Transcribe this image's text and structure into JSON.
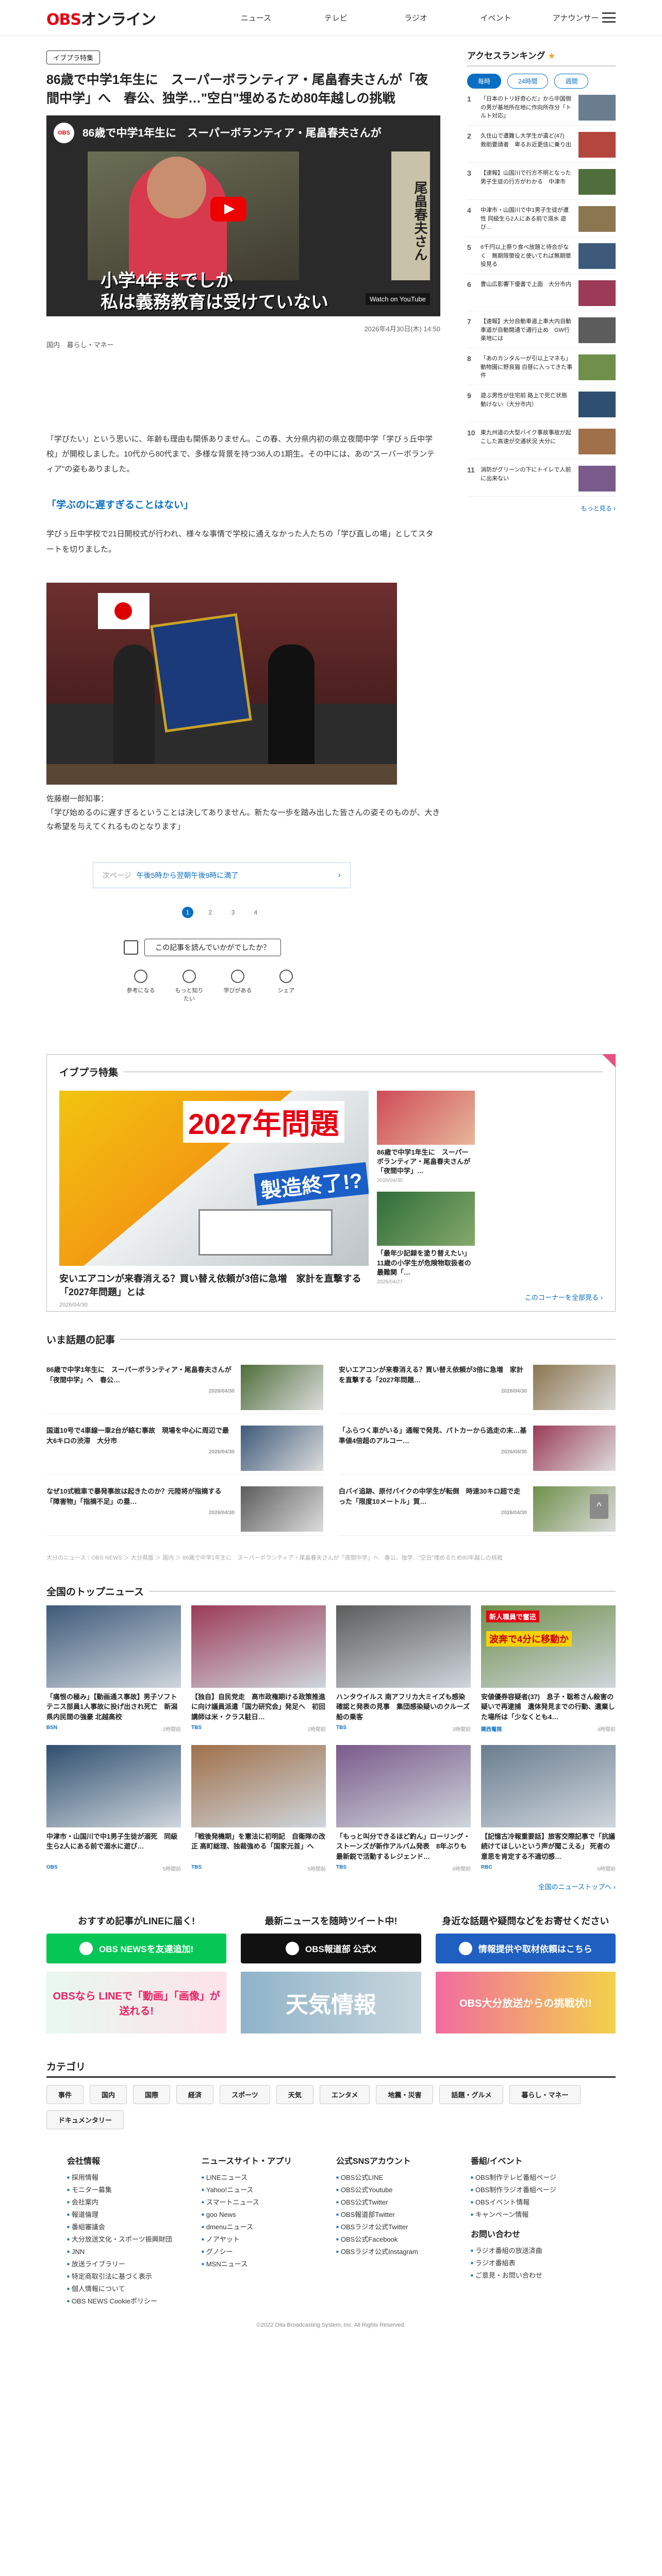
{
  "header": {
    "logo_prefix": "OBS",
    "logo_suffix": "オンライン",
    "nav": [
      "ニュース",
      "テレビ",
      "ラジオ",
      "イベント",
      "アナウンサー"
    ]
  },
  "article": {
    "badge": "イブプラ特集",
    "title": "86歳で中学1年生に　スーパーボランティア・尾畠春夫さんが「夜間中学」へ　春公、独学…\"空白\"埋めるため80年越しの挑戦",
    "video": {
      "channel": "OBS",
      "title": "86歳で中学1年生に　スーパーボランティア・尾畠春夫さんが",
      "sign": "尾畠春夫さん",
      "caption_line1": "小学4年までしか",
      "caption_line2": "私は義務教育は受けていない",
      "watch": "Watch on YouTube"
    },
    "date": "2026年4月30日(木) 14:50",
    "tags": [
      "国内",
      "暮らし・マネー"
    ],
    "paragraph1": "「学びたい」という思いに、年齢も理由も関係ありません。この春、大分県内初の県立夜間中学「学びぅ丘中学校」が開校しました。10代から80代まで、多様な背景を持つ36人の1期生。その中には、あの\"スーパーボランティア\"の姿もありました。",
    "subhead": "「学ぶのに遅すぎることはない」",
    "paragraph2": "学びぅ丘中学校で21日開校式が行われ、様々な事情で学校に通えなかった人たちの「学び直しの場」としてスタートを切りました。",
    "quote_name": "佐藤樹一郎知事：",
    "quote_text": "「学び始めるのに遅すぎるということは決してありません。新たな一歩を踏み出した皆さんの姿そのものが、大きな希望を与えてくれるものとなります」",
    "next_label": "次ページ",
    "next_text": "午後5時から翌朝午後9時に満了",
    "next_arrow": "›",
    "pages": [
      "1",
      "2",
      "3",
      "4"
    ],
    "read_question": "この記事を読んでいかがでしたか？",
    "reactions": [
      "参考になる",
      "もっと知りたい",
      "学びがある",
      "シェア"
    ]
  },
  "feature": {
    "heading": "イブプラ特集",
    "main_title": "安いエアコンが来春消える？買い替え依頼が3倍に急増　家計を直撃する「2027年問題」とは",
    "main_date": "2026/04/30",
    "img_text1": "2027年問題",
    "img_text2": "製造終了!?",
    "side": [
      {
        "title": "86歳で中学1年生に　スーパーボランティア・尾畠春夫さんが「夜間中学」…",
        "date": "2026/04/30"
      },
      {
        "title": "「最年少記録を塗り替えたい」11歳の小学生が危険物取扱者の最難関「…",
        "date": "2026/04/27"
      }
    ],
    "more": "このコーナーを全部見る ›"
  },
  "hot": {
    "heading": "いま話題の記事",
    "items": [
      {
        "title": "86歳で中学1年生に　スーパーボランティア・尾畠春夫さんが「夜間中学」へ　春公…",
        "date": "2026/04/30"
      },
      {
        "title": "安いエアコンが来春消える？買い替え依頼が3倍に急増　家計を直撃する「2027年問題…",
        "date": "2026/04/30"
      },
      {
        "title": "国道10号で4車線一車2台が絡む事故　現場を中心に周辺で最大6キロの渋滞　大分市",
        "date": "2026/04/30"
      },
      {
        "title": "「ふらつく車がいる」通報で発見、パトカーから逃走の末…基準値4倍超のアルコー…",
        "date": "2026/04/30"
      },
      {
        "title": "なぜ10式戦車で暴発事故は起きたのか？元陸将が指摘する「障害物」「指摘不足」の塁…",
        "date": "2026/04/30"
      },
      {
        "title": "白バイ追跡、原付バイクの中学生が転倒　時速30キロ超で走った「限度10メートル」質…",
        "date": "2026/04/30"
      }
    ]
  },
  "breadcrumb": "大分のニュース｜OBS NEWS ＞ 大分県版 ＞ 国内 ＞ 86歳で中学1年生に　スーパーボランティア・尾畠春夫さんが「夜間中学」へ　春公、独学…\"空白\"埋めるため80年越しの挑戦",
  "national": {
    "heading": "全国のトップニュース",
    "items": [
      {
        "title": "「痛恨の極み」【動画通ス事故】男子ソフトテニス部員1人事故に投げ出され死亡　新潟県内民間の強豪 北越高校",
        "src": "BSN",
        "date": "2時間前"
      },
      {
        "title": "【独自】自民党走　高市政権期ける政策推進に向け議員派遣「国力研究会」発足へ　初回講師は米・クラス駐日…",
        "src": "TBS",
        "date": "2時間前"
      },
      {
        "title": "ハンタウイルス 南アフリカ大ミイズも感染確認と発表の見事　集団感染疑いのクルーズ船の乗客",
        "src": "TBS",
        "date": "3時間前"
      },
      {
        "title": "安値優券容疑者(37)　息子・聡希さん殺害の疑いで再逮捕　遺体発見までの行動、遺棄した場所は「少なくとも4…",
        "src": "関西電視",
        "date": "4時間前"
      },
      {
        "title": "中津市・山国川で中1男子生徒が溺死　同級生ら2人にある前で溺水に遊び…",
        "src": "OBS",
        "date": "5時間前"
      },
      {
        "title": "「戦後発機期」を憲法に初明記　自衛隊の改正 高町総理、独裁強める「国家元首」へ",
        "src": "TBS",
        "date": "5時間前"
      },
      {
        "title": "「もっと叫分できるほど釣ん」ローリング・ストーンズが新作アルバム発表　8年ぶりも最新鋭で活動するレジェンド…",
        "src": "TBS",
        "date": "6時間前"
      },
      {
        "title": "【記憶古冷報重要話】旅客交際記事で「抗議続けてほしいという声が聞こえる」 死者の意思を肯定する不適切感…",
        "src": "RBC",
        "date": "6時間前"
      }
    ],
    "img_text": "新人職員で奮迅",
    "img_text2": "波奔で4分に移動か",
    "more": "全国のニューストップへ ›"
  },
  "promo": [
    {
      "heading": "おすすめ記事がLINEに届く!",
      "button": "OBS NEWSを友達追加!",
      "banner": "OBSなら LINEで「動画」「画像」が送れる!",
      "color": "#06c755"
    },
    {
      "heading": "最新ニュースを随時ツイート中!",
      "button": "OBS報道部 公式X",
      "banner": "天気情報",
      "color": "#111111"
    },
    {
      "heading": "身近な話題や疑問などをお寄せください",
      "button": "情報提供や取材依頼はこちら",
      "banner": "OBS大分放送からの挑戦状!!",
      "color": "#1f5fbf"
    }
  ],
  "categories": {
    "heading": "カテゴリ",
    "items": [
      "事件",
      "国内",
      "国際",
      "経済",
      "スポーツ",
      "天気",
      "エンタメ",
      "地震・災害",
      "話題・グルメ",
      "暮らし・マネー",
      "ドキュメンタリー"
    ]
  },
  "footer": {
    "cols": [
      {
        "heading": "会社情報",
        "items": [
          "採用情報",
          "モニター募集",
          "会社案内",
          "報道倫理",
          "番組審議会",
          "大分放送文化・スポーツ振興財団",
          "JNN",
          "放送ライブラリー",
          "特定商取引法に基づく表示",
          "個人情報について",
          "OBS NEWS Cookieポリシー"
        ]
      },
      {
        "heading": "ニュースサイト・アプリ",
        "items": [
          "LINEニュース",
          "Yahoo!ニュース",
          "スマートニュース",
          "goo News",
          "dmenuニュース",
          "ノアヤット",
          "グノシー",
          "MSNニュース"
        ]
      },
      {
        "heading": "公式SNSアカウント",
        "items": [
          "OBS公式LINE",
          "OBS公式Youtube",
          "OBS公式Twitter",
          "OBS報道部Twitter",
          "OBSラジオ公式Twitter",
          "OBS公式Facebook",
          "OBSラジオ公式Instagram"
        ]
      },
      {
        "heading": "番組/イベント",
        "items": [
          "OBS制作テレビ番組ページ",
          "OBS制作ラジオ番組ページ",
          "OBSイベント情報",
          "キャンペーン情報"
        ]
      },
      {
        "heading": "お問い合わせ",
        "items": [
          "ラジオ番組の放送済曲",
          "ラジオ番組表",
          "ご意見・お問い合わせ"
        ]
      }
    ],
    "copyright": "©2022 Oita Broadcasting System, Inc. All Rights Reserved."
  },
  "sidebar": {
    "heading": "アクセスランキング",
    "star": "★",
    "tabs": [
      "毎時",
      "24時間",
      "週間"
    ],
    "items": [
      "「日本のトリ好奇心だ」から中国側の男が基地所在地に作向所存分「トルト対応」",
      "久住山で遭難し大学生が遺ど(47)　救助要請者　卑るお近更佳に乗り出",
      "【速報】山国川で行方不明となった男子生徒の行方がわかる　中津市",
      "中津市・山国川で中1男子生徒が遭性 同級生ら2人にある前で溺水 遊び…",
      "6千円以上祭り食べ放題と待合がなく　無期限懲役と使いてれば無期懲役見る",
      "豊山広影響下優書で上面　大分市内",
      "【速報】大分自動車道上車大内自動車道が自動開通で通行止め　GW行楽地には",
      "「あのカンタル一が引以上マネも」動物園に野良猫 白昼に入ってきた事件",
      "遊ぶ男性が住宅前 路上で死亡状態 動けない（大分市内）",
      "東九州道の大型バイク事故事故が起こした高速が交通状況 大分に",
      "消防がグリーンの下にトイレで人前に出来ない"
    ],
    "more": "もっと見る ›"
  },
  "totop": "^"
}
